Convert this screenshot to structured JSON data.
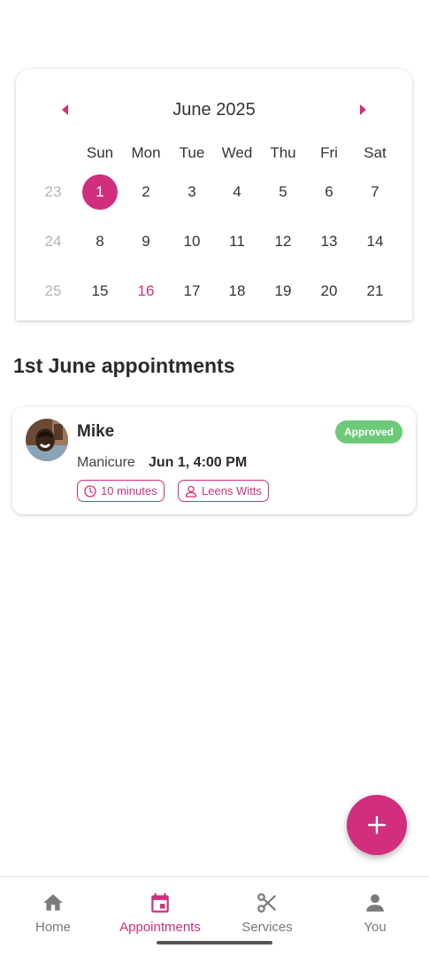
{
  "colors": {
    "accent": "#d12e7d",
    "approved": "#6cc978",
    "muted": "#b4b4b4"
  },
  "calendar": {
    "month_title": "June 2025",
    "weekdays": [
      "Sun",
      "Mon",
      "Tue",
      "Wed",
      "Thu",
      "Fri",
      "Sat"
    ],
    "weeks": [
      {
        "number": "23",
        "days": [
          "1",
          "2",
          "3",
          "4",
          "5",
          "6",
          "7"
        ]
      },
      {
        "number": "24",
        "days": [
          "8",
          "9",
          "10",
          "11",
          "12",
          "13",
          "14"
        ]
      },
      {
        "number": "25",
        "days": [
          "15",
          "16",
          "17",
          "18",
          "19",
          "20",
          "21"
        ]
      }
    ],
    "selected_day": "1",
    "today_day": "16"
  },
  "appointments": {
    "section_title": "1st June appointments",
    "items": [
      {
        "client": "Mike",
        "status": "Approved",
        "service": "Manicure",
        "time": "Jun 1, 4:00 PM",
        "duration": "10 minutes",
        "staff": "Leens Witts"
      }
    ]
  },
  "fab": {
    "icon": "plus-icon"
  },
  "bottom_nav": {
    "items": [
      {
        "label": "Home",
        "icon": "home-icon"
      },
      {
        "label": "Appointments",
        "icon": "calendar-icon",
        "active": true
      },
      {
        "label": "Services",
        "icon": "scissors-icon"
      },
      {
        "label": "You",
        "icon": "person-icon"
      }
    ]
  }
}
